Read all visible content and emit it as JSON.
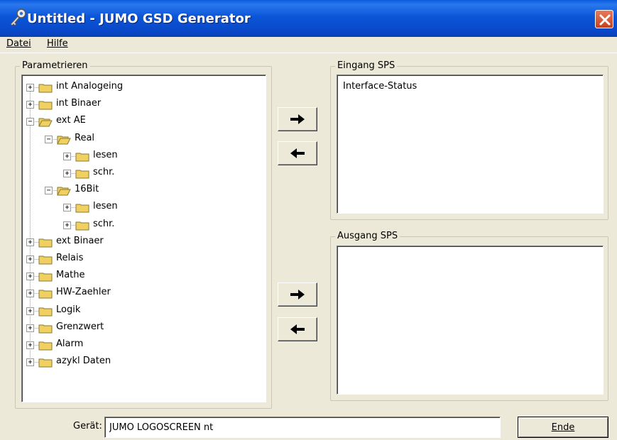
{
  "window": {
    "title": "Untitled - JUMO GSD Generator"
  },
  "menu": {
    "datei": "Datei",
    "hilfe": "Hilfe"
  },
  "parametrieren": {
    "legend": "Parametrieren",
    "tree": [
      {
        "label": "int Analogeing",
        "level": 0,
        "expander": "+",
        "open": false
      },
      {
        "label": "int Binaer",
        "level": 0,
        "expander": "+",
        "open": false
      },
      {
        "label": "ext AE",
        "level": 0,
        "expander": "−",
        "open": true
      },
      {
        "label": "Real",
        "level": 1,
        "expander": "−",
        "open": true
      },
      {
        "label": "lesen",
        "level": 2,
        "expander": "+",
        "open": false
      },
      {
        "label": "schr.",
        "level": 2,
        "expander": "+",
        "open": false
      },
      {
        "label": "16Bit",
        "level": 1,
        "expander": "−",
        "open": true
      },
      {
        "label": "lesen",
        "level": 2,
        "expander": "+",
        "open": false
      },
      {
        "label": "schr.",
        "level": 2,
        "expander": "+",
        "open": false
      },
      {
        "label": "ext Binaer",
        "level": 0,
        "expander": "+",
        "open": false
      },
      {
        "label": "Relais",
        "level": 0,
        "expander": "+",
        "open": false
      },
      {
        "label": "Mathe",
        "level": 0,
        "expander": "+",
        "open": false
      },
      {
        "label": "HW-Zaehler",
        "level": 0,
        "expander": "+",
        "open": false
      },
      {
        "label": "Logik",
        "level": 0,
        "expander": "+",
        "open": false
      },
      {
        "label": "Grenzwert",
        "level": 0,
        "expander": "+",
        "open": false
      },
      {
        "label": "Alarm",
        "level": 0,
        "expander": "+",
        "open": false
      },
      {
        "label": "azykl Daten",
        "level": 0,
        "expander": "+",
        "open": false
      }
    ]
  },
  "eingang": {
    "legend": "Eingang SPS",
    "items": [
      "Interface-Status"
    ]
  },
  "ausgang": {
    "legend": "Ausgang SPS",
    "items": []
  },
  "buttons": {
    "add_arrow": "➜",
    "remove_arrow": "🡐"
  },
  "footer": {
    "device_label": "Gerät:",
    "device_value": "JUMO LOGOSCREEN nt",
    "end_label": "Ende"
  },
  "colors": {
    "titlebar": "#0a5ce0",
    "window_bg": "#ece9d8",
    "folder": "#f0d060"
  }
}
